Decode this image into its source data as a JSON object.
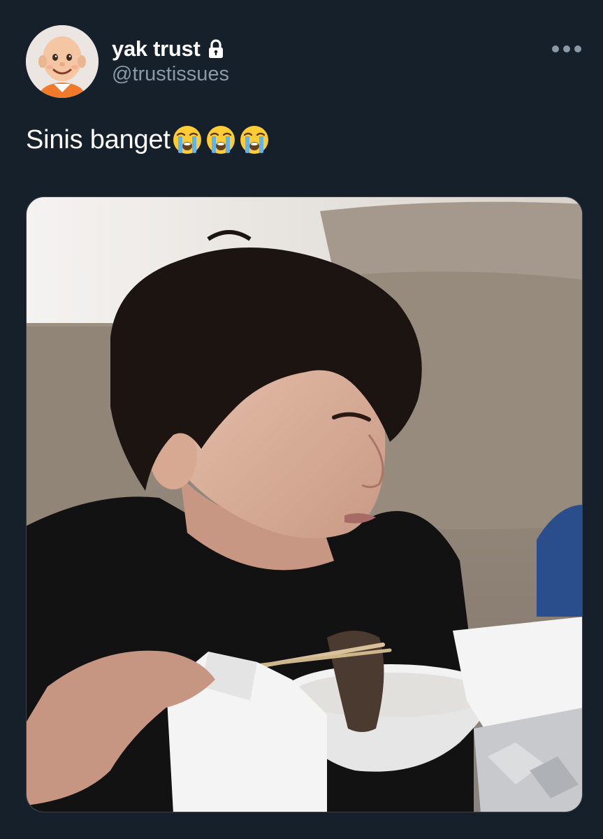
{
  "author": {
    "display_name": "yak trust",
    "handle": "@trustissues",
    "protected_icon": "lock-icon",
    "avatar_icon": "cartoon-avatar"
  },
  "tweet": {
    "text": "Sinis banget",
    "emojis": [
      "loudly-crying-face",
      "loudly-crying-face",
      "loudly-crying-face"
    ]
  },
  "menu": {
    "icon": "more-options-icon"
  },
  "media": {
    "type": "photo",
    "subject": "person-eating-noodles-photo"
  },
  "colors": {
    "background": "#15202b",
    "text_primary": "#ffffff",
    "text_secondary": "#8b98a5",
    "border": "#38444d"
  }
}
